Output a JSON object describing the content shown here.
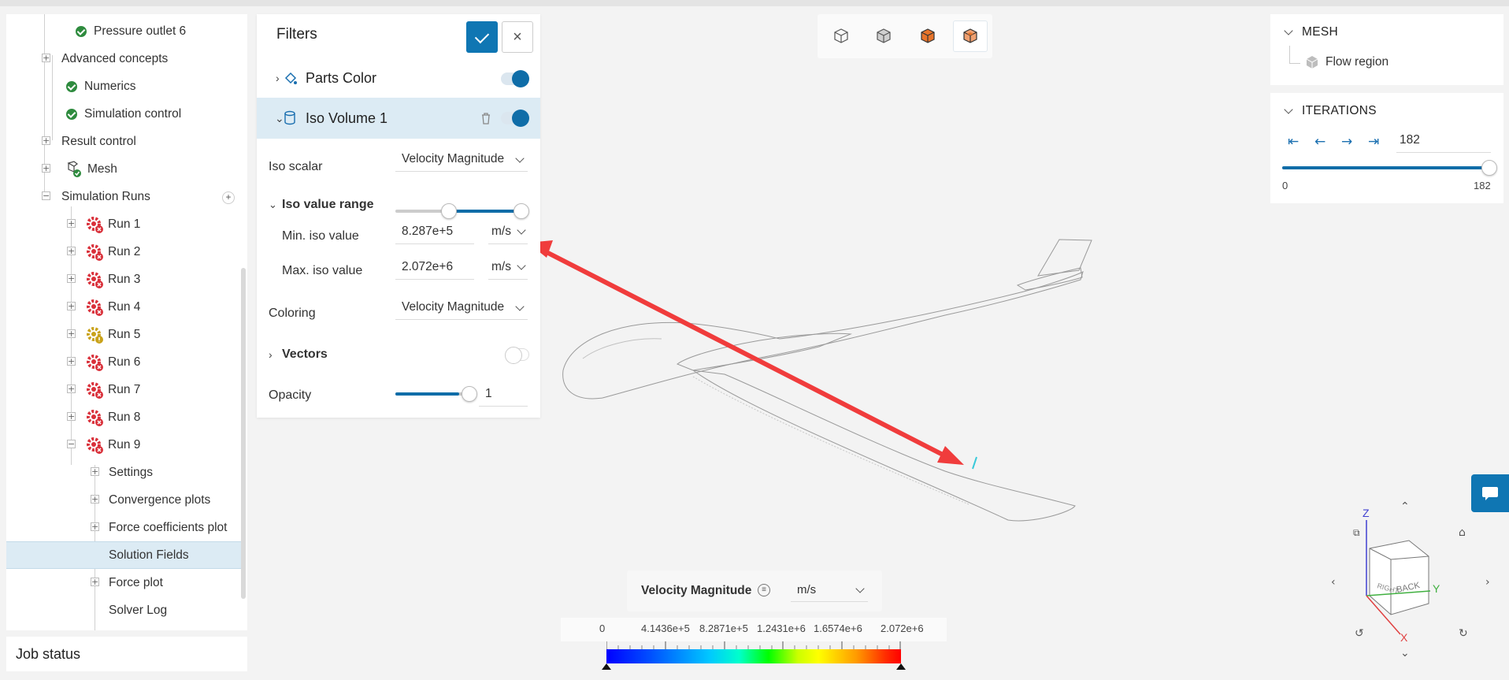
{
  "tree": {
    "items": [
      {
        "label": "Pressure outlet 6"
      },
      {
        "label": "Advanced concepts"
      },
      {
        "label": "Numerics"
      },
      {
        "label": "Simulation control"
      },
      {
        "label": "Result control"
      },
      {
        "label": "Mesh"
      },
      {
        "label": "Simulation Runs"
      },
      {
        "label": "Run 1"
      },
      {
        "label": "Run 2"
      },
      {
        "label": "Run 3"
      },
      {
        "label": "Run 4"
      },
      {
        "label": "Run 5"
      },
      {
        "label": "Run 6"
      },
      {
        "label": "Run 7"
      },
      {
        "label": "Run 8"
      },
      {
        "label": "Run 9"
      },
      {
        "label": "Settings"
      },
      {
        "label": "Convergence plots"
      },
      {
        "label": "Force coefficients plot"
      },
      {
        "label": "Solution Fields"
      },
      {
        "label": "Force plot"
      },
      {
        "label": "Solver Log"
      }
    ],
    "job_status": "Job status"
  },
  "filters": {
    "title": "Filters",
    "close_label": "×",
    "parts_color": "Parts Color",
    "iso_volume": "Iso Volume 1",
    "iso_scalar_label": "Iso scalar",
    "iso_scalar_value": "Velocity Magnitude",
    "iso_range_label": "Iso value range",
    "min_label": "Min. iso value",
    "min_value": "8.287e+5",
    "max_label": "Max. iso value",
    "max_value": "2.072e+6",
    "unit": "m/s",
    "coloring_label": "Coloring",
    "coloring_value": "Velocity Magnitude",
    "vectors_label": "Vectors",
    "opacity_label": "Opacity",
    "opacity_value": "1",
    "opacity_level": 0.9
  },
  "mesh_panel": {
    "title": "MESH",
    "item": "Flow region"
  },
  "iterations": {
    "title": "ITERATIONS",
    "value": "182",
    "min": "0",
    "max": "182",
    "fraction": 1.0
  },
  "legend": {
    "field": "Velocity Magnitude",
    "unit": "m/s",
    "ticks": [
      "0",
      "4.1436e+5",
      "8.2871e+5",
      "1.2431e+6",
      "1.6574e+6",
      "2.072e+6"
    ]
  },
  "gizmo": {
    "z": "Z",
    "y": "Y",
    "x": "X",
    "face_right": "RIGHT",
    "face_back": "BACK"
  },
  "colors": {
    "accent": "#0f76b3",
    "arrow": "#f03c3c",
    "error": "#d9303a",
    "warning": "#c9a21a",
    "ok": "#2e8b3e"
  }
}
